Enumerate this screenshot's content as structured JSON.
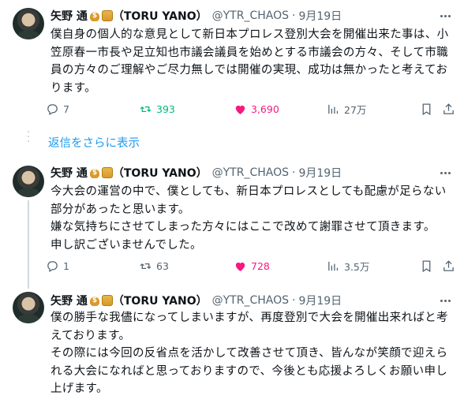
{
  "tweets": [
    {
      "name": "矢野 通",
      "title_suffix": "（TORU YANO）",
      "handle": "@YTR_CHAOS",
      "sep": "·",
      "date": "9月19日",
      "text": "僕自身の個人的な意見として新日本プロレス登別大会を開催出来た事は、小\n笠原春一市長や足立知也市議会議員を始めとする市議会の方々、そして市職\n員の方々のご理解やご尽力無しでは開催の実現、成功は無かったと考えてお\nります。",
      "replies": "7",
      "retweets": "393",
      "likes": "3,690",
      "views": "27万"
    },
    {
      "name": "矢野 通",
      "title_suffix": "（TORU YANO）",
      "handle": "@YTR_CHAOS",
      "sep": "·",
      "date": "9月19日",
      "text": "今大会の運営の中で、僕としても、新日本プロレスとしても配慮が足らない\n部分があったと思います。\n嫌な気持ちにさせてしまった方々にはここで改めて謝罪させて頂きます。\n申し訳ございませんでした。",
      "replies": "1",
      "retweets": "63",
      "likes": "728",
      "views": "3.5万"
    },
    {
      "name": "矢野 通",
      "title_suffix": "（TORU YANO）",
      "handle": "@YTR_CHAOS",
      "sep": "·",
      "date": "9月19日",
      "text": "僕の勝手な我儘になってしまいますが、再度登別で大会を開催出来ればと考\nえております。\nその際には今回の反省点を活かして改善させて頂き、皆んなが笑顔で迎えら\nれる大会になればと思っておりますので、今後とも応援よろしくお願い申し\n上げます。"
    }
  ],
  "show_more_replies": "返信をさらに表示",
  "colors": {
    "text": "#0f1419",
    "secondary": "#536471",
    "retweet_active": "#00ba7c",
    "like_active": "#f91880",
    "link": "#1d9bf0",
    "thread_line": "#cfd9de"
  },
  "icons": [
    "more-icon",
    "reply-icon",
    "retweet-icon",
    "like-icon",
    "views-icon",
    "bookmark-icon",
    "share-icon",
    "money-bag-emoji",
    "money-bills-emoji"
  ]
}
